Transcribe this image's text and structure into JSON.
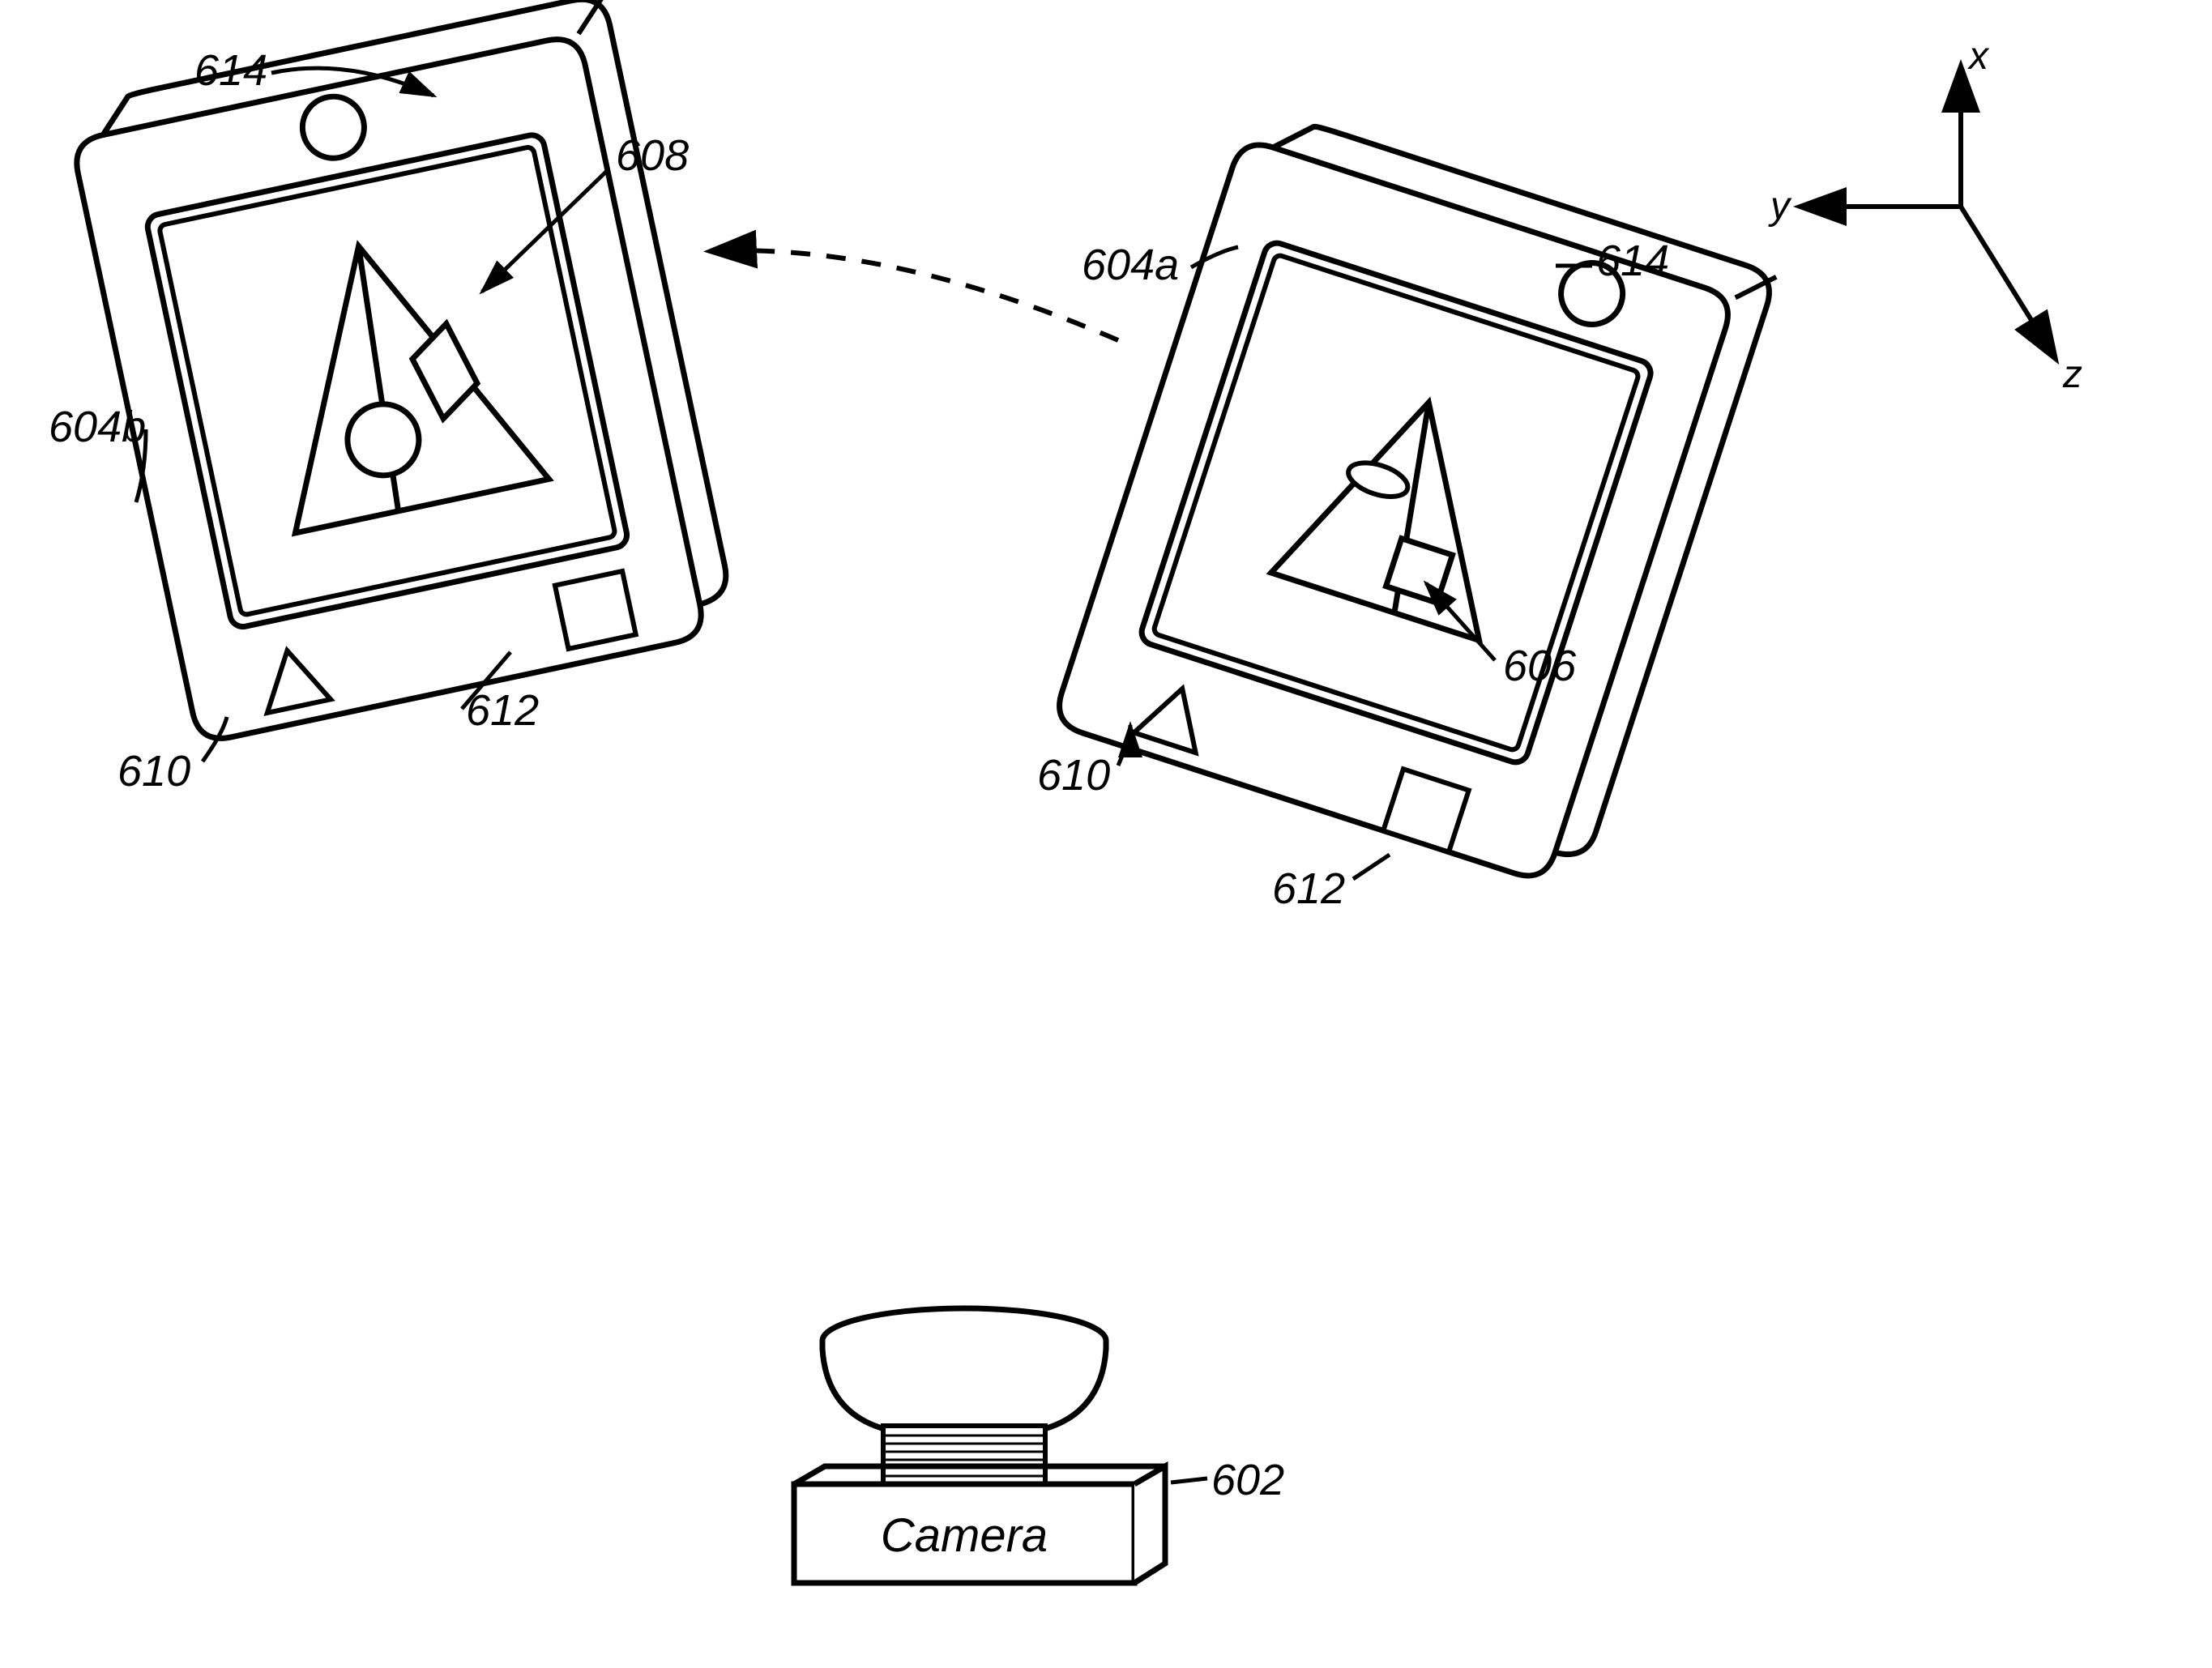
{
  "labels": {
    "ref614a": "614",
    "ref608": "608",
    "ref604b": "604b",
    "ref612a": "612",
    "ref610a": "610",
    "ref604a": "604a",
    "ref614b": "614",
    "ref606": "606",
    "ref610b": "610",
    "ref612b": "612",
    "ref602": "602",
    "camera": "Camera",
    "axis_x": "x",
    "axis_y": "y",
    "axis_z": "z"
  }
}
